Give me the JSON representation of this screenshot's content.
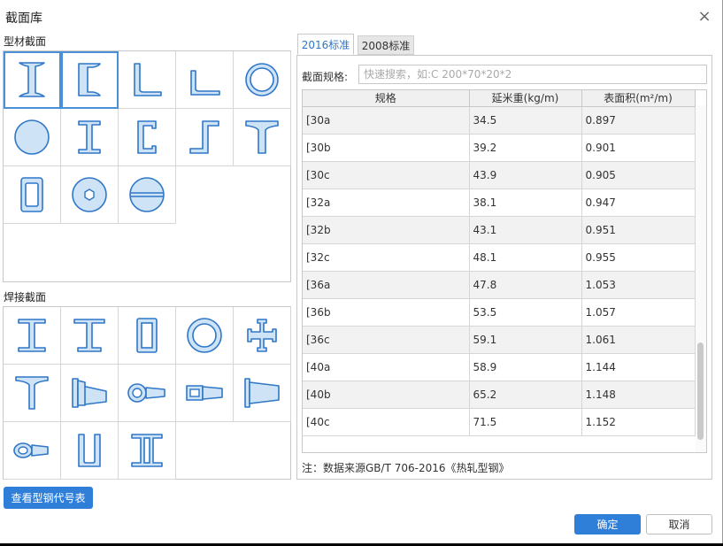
{
  "dialog": {
    "title": "截面库",
    "close_symbol": "×"
  },
  "left": {
    "section1_label": "型材截面",
    "section2_label": "焊接截面",
    "view_codes_button": "查看型钢代号表",
    "rolled_icons": [
      "i-beam-icon",
      "channel-icon",
      "equal-angle-icon",
      "unequal-angle-icon",
      "round-tube-icon",
      "solid-round-icon",
      "h-beam-icon",
      "lipped-channel-icon",
      "z-section-icon",
      "t-section-icon",
      "rect-tube-icon",
      "hex-nut-icon",
      "semicircle-split-icon"
    ],
    "welded_icons": [
      "welded-i-icon",
      "welded-h-icon",
      "welded-box-icon",
      "welded-tube-icon",
      "welded-cross-icon",
      "welded-t-icon",
      "tapered-i-icon",
      "tapered-tube-icon",
      "tapered-box-icon",
      "tapered-h-icon",
      "tapered-ellipse-icon",
      "welded-u-icon",
      "double-i-icon"
    ]
  },
  "right": {
    "tabs": [
      {
        "label": "2016标准",
        "active": true
      },
      {
        "label": "2008标准",
        "active": false
      }
    ],
    "search_label": "截面规格:",
    "search_placeholder": "快速搜索，如:C 200*70*20*2",
    "table": {
      "headers": [
        "规格",
        "延米重(kg/m)",
        "表面积(m²/m)"
      ],
      "rows": [
        [
          "[30a",
          "34.5",
          "0.897"
        ],
        [
          "[30b",
          "39.2",
          "0.901"
        ],
        [
          "[30c",
          "43.9",
          "0.905"
        ],
        [
          "[32a",
          "38.1",
          "0.947"
        ],
        [
          "[32b",
          "43.1",
          "0.951"
        ],
        [
          "[32c",
          "48.1",
          "0.955"
        ],
        [
          "[36a",
          "47.8",
          "1.053"
        ],
        [
          "[36b",
          "53.5",
          "1.057"
        ],
        [
          "[36c",
          "59.1",
          "1.061"
        ],
        [
          "[40a",
          "58.9",
          "1.144"
        ],
        [
          "[40b",
          "65.2",
          "1.148"
        ],
        [
          "[40c",
          "71.5",
          "1.152"
        ]
      ]
    },
    "note": "注：数据来源GB/T 706-2016《热轧型钢》"
  },
  "footer": {
    "ok_label": "确定",
    "cancel_label": "取消"
  },
  "colors": {
    "accent": "#2f7fd9",
    "shape_fill": "#cfe3f7",
    "shape_stroke": "#2f77c7"
  }
}
